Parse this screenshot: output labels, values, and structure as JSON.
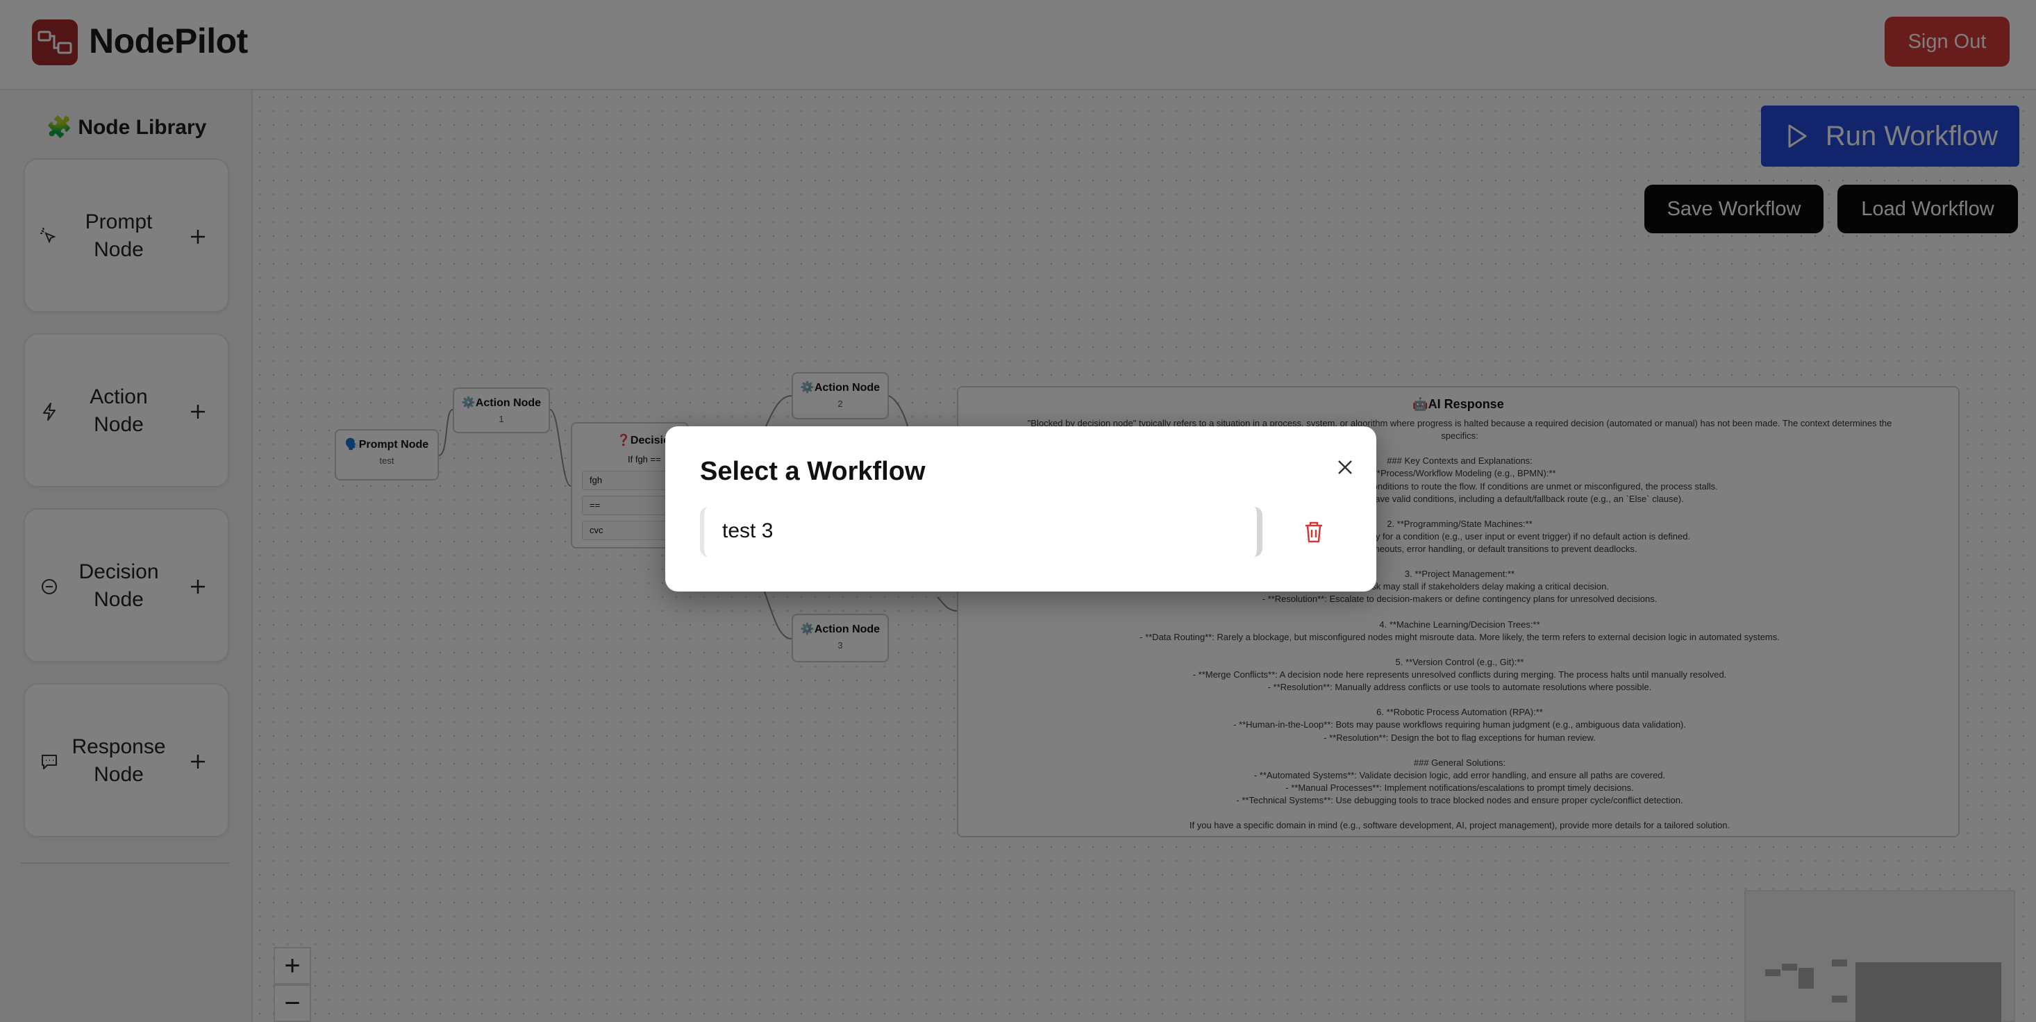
{
  "app": {
    "name": "NodePilot",
    "logo_icon": "workflow-logo-icon",
    "brand_color": "#a42a2a",
    "sign_out_label": "Sign Out"
  },
  "sidebar": {
    "title": "🧩 Node Library",
    "items": [
      {
        "label_line1": "Prompt",
        "label_line2": "Node",
        "icon": "sparkle-pointer-icon"
      },
      {
        "label_line1": "Action",
        "label_line2": "Node",
        "icon": "lightning-icon"
      },
      {
        "label_line1": "Decision",
        "label_line2": "Node",
        "icon": "circle-minus-icon"
      },
      {
        "label_line1": "Response",
        "label_line2": "Node",
        "icon": "message-square-icon"
      }
    ],
    "add_icon": "plus-icon"
  },
  "toolbar": {
    "run_label": "Run Workflow",
    "run_icon": "play-icon",
    "run_color": "#2448d8",
    "save_label": "Save Workflow",
    "load_label": "Load Workflow"
  },
  "canvas": {
    "nodes": {
      "prompt": {
        "title": "🗣️Prompt Node",
        "sub": "test"
      },
      "action1": {
        "title": "⚙️Action Node",
        "sub": "1"
      },
      "action2": {
        "title": "⚙️Action Node",
        "sub": "2"
      },
      "action3": {
        "title": "⚙️Action Node",
        "sub": "3"
      },
      "decision": {
        "title": "❓Decisio",
        "cond": "If fgh ==",
        "rows": [
          "fgh",
          "==",
          "cvc"
        ]
      }
    },
    "ai_response": {
      "title": "🤖AI Response",
      "lines": [
        "\"Blocked by decision node\" typically refers to a situation in a process, system, or algorithm where progress is halted because a required decision (automated or manual) has not been made. The context determines the",
        "specifics:",
        "",
        "### Key Contexts and Explanations:",
        "1. **Process/Workflow Modeling (e.g., BPMN):**",
        "- **Issue**: A decision gateway evaluates conditions to route the flow. If conditions are unmet or misconfigured, the process stalls.",
        "- **Resolution**: Ensure all paths have valid conditions, including a default/fallback route (e.g., an `Else` clause).",
        "",
        "2. **Programming/State Machines:**",
        "- **Issue**: Code may wait indefinitely for a condition (e.g., user input or event trigger) if no default action is defined.",
        "- **Resolution**: Add timeouts, error handling, or default transitions to prevent deadlocks.",
        "",
        "3. **Project Management:**",
        "- **Issue**: A task may stall if stakeholders delay making a critical decision.",
        "- **Resolution**: Escalate to decision-makers or define contingency plans for unresolved decisions.",
        "",
        "4. **Machine Learning/Decision Trees:**",
        "- **Data Routing**: Rarely a blockage, but misconfigured nodes might misroute data. More likely, the term refers to external decision logic in automated systems.",
        "",
        "5. **Version Control (e.g., Git):**",
        "- **Merge Conflicts**: A decision node here represents unresolved conflicts during merging. The process halts until manually resolved.",
        "- **Resolution**: Manually address conflicts or use tools to automate resolutions where possible.",
        "",
        "6. **Robotic Process Automation (RPA):**",
        "- **Human-in-the-Loop**: Bots may pause workflows requiring human judgment (e.g., ambiguous data validation).",
        "- **Resolution**: Design the bot to flag exceptions for human review.",
        "",
        "### General Solutions:",
        "- **Automated Systems**: Validate decision logic, add error handling, and ensure all paths are covered.",
        "- **Manual Processes**: Implement notifications/escalations to prompt timely decisions.",
        "- **Technical Systems**: Use debugging tools to trace blocked nodes and ensure proper cycle/conflict detection.",
        "",
        "If you have a specific domain in mind (e.g., software development, AI, project management), provide more details for a tailored solution."
      ]
    },
    "zoom_in": "+",
    "zoom_out": "−"
  },
  "modal": {
    "title": "Select a Workflow",
    "close_icon": "close-icon",
    "workflows": [
      {
        "name": "test 3",
        "delete_icon": "trash-icon",
        "delete_color": "#d03838"
      }
    ]
  }
}
